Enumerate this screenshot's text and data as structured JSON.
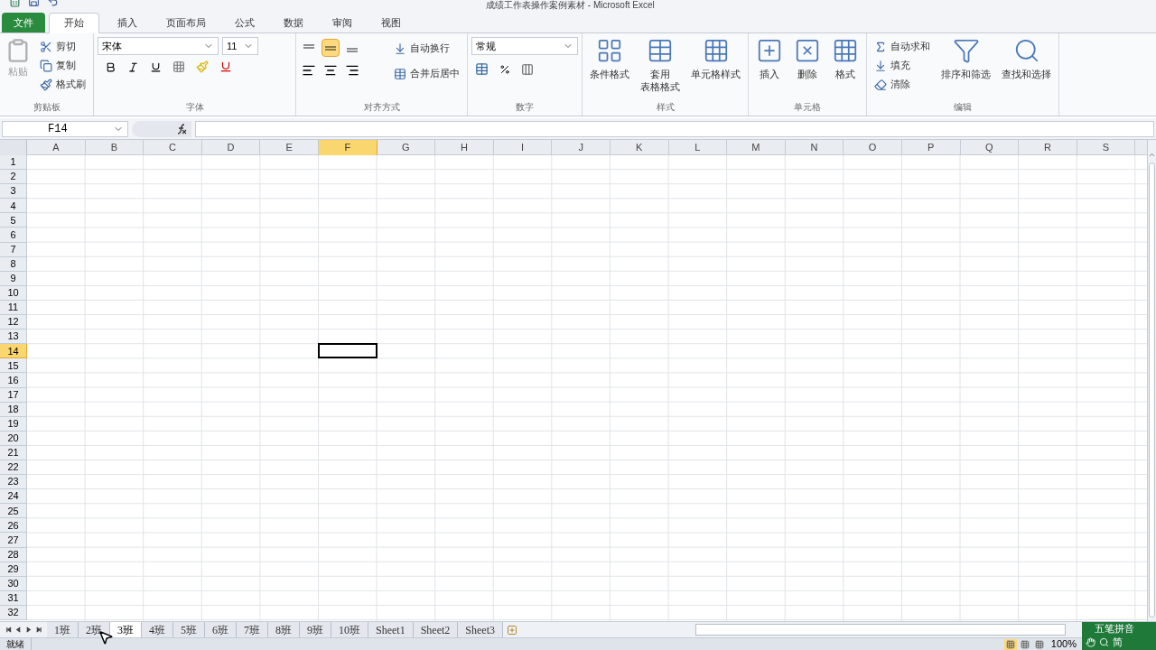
{
  "title": "成绩工作表操作案例素材 - Microsoft Excel",
  "menu_tabs": [
    {
      "label": "文件",
      "kind": "file",
      "selected": false
    },
    {
      "label": "开始",
      "kind": "tab",
      "selected": true
    },
    {
      "label": "插入",
      "kind": "tab",
      "selected": false
    },
    {
      "label": "页面布局",
      "kind": "tab",
      "selected": false
    },
    {
      "label": "公式",
      "kind": "tab",
      "selected": false
    },
    {
      "label": "数据",
      "kind": "tab",
      "selected": false
    },
    {
      "label": "审阅",
      "kind": "tab",
      "selected": false
    },
    {
      "label": "视图",
      "kind": "tab",
      "selected": false
    }
  ],
  "ribbon": {
    "clipboard": {
      "label": "剪贴板",
      "paste": {
        "label": "粘贴",
        "disabled": true
      },
      "items": [
        "剪切",
        "复制",
        "格式刷"
      ]
    },
    "font": {
      "label": "字体",
      "font_name": "宋体",
      "font_size": "11"
    },
    "alignment": {
      "label": "对齐方式",
      "vertical": [
        {
          "selected": false
        },
        {
          "selected": true
        },
        {
          "selected": false
        }
      ],
      "wrap": "自动换行",
      "merge": "合并后居中"
    },
    "number": {
      "label": "数字",
      "format": "常规"
    },
    "styles": {
      "label": "样式",
      "items": [
        {
          "lines": [
            "条件格式"
          ]
        },
        {
          "lines": [
            "套用",
            "表格格式"
          ]
        },
        {
          "lines": [
            "单元格样式"
          ]
        }
      ]
    },
    "cells": {
      "label": "单元格",
      "items": [
        "插入",
        "删除",
        "格式"
      ]
    },
    "editing": {
      "label": "编辑",
      "items": [
        "自动求和",
        "填充",
        "清除"
      ],
      "big": [
        "排序和筛选",
        "查找和选择"
      ]
    }
  },
  "name_box": "F14",
  "columns": [
    {
      "label": "A",
      "selected": false
    },
    {
      "label": "B",
      "selected": false
    },
    {
      "label": "C",
      "selected": false
    },
    {
      "label": "D",
      "selected": false
    },
    {
      "label": "E",
      "selected": false
    },
    {
      "label": "F",
      "selected": true
    },
    {
      "label": "G",
      "selected": false
    },
    {
      "label": "H",
      "selected": false
    },
    {
      "label": "I",
      "selected": false
    },
    {
      "label": "J",
      "selected": false
    },
    {
      "label": "K",
      "selected": false
    },
    {
      "label": "L",
      "selected": false
    },
    {
      "label": "M",
      "selected": false
    },
    {
      "label": "N",
      "selected": false
    },
    {
      "label": "O",
      "selected": false
    },
    {
      "label": "P",
      "selected": false
    },
    {
      "label": "Q",
      "selected": false
    },
    {
      "label": "R",
      "selected": false
    },
    {
      "label": "S",
      "selected": false
    }
  ],
  "rows": [
    {
      "label": "1",
      "selected": false
    },
    {
      "label": "2",
      "selected": false
    },
    {
      "label": "3",
      "selected": false
    },
    {
      "label": "4",
      "selected": false
    },
    {
      "label": "5",
      "selected": false
    },
    {
      "label": "6",
      "selected": false
    },
    {
      "label": "7",
      "selected": false
    },
    {
      "label": "8",
      "selected": false
    },
    {
      "label": "9",
      "selected": false
    },
    {
      "label": "10",
      "selected": false
    },
    {
      "label": "11",
      "selected": false
    },
    {
      "label": "12",
      "selected": false
    },
    {
      "label": "13",
      "selected": false
    },
    {
      "label": "14",
      "selected": true
    },
    {
      "label": "15",
      "selected": false
    },
    {
      "label": "16",
      "selected": false
    },
    {
      "label": "17",
      "selected": false
    },
    {
      "label": "18",
      "selected": false
    },
    {
      "label": "19",
      "selected": false
    },
    {
      "label": "20",
      "selected": false
    },
    {
      "label": "21",
      "selected": false
    },
    {
      "label": "22",
      "selected": false
    },
    {
      "label": "23",
      "selected": false
    },
    {
      "label": "24",
      "selected": false
    },
    {
      "label": "25",
      "selected": false
    },
    {
      "label": "26",
      "selected": false
    },
    {
      "label": "27",
      "selected": false
    },
    {
      "label": "28",
      "selected": false
    },
    {
      "label": "29",
      "selected": false
    },
    {
      "label": "30",
      "selected": false
    },
    {
      "label": "31",
      "selected": false
    },
    {
      "label": "32",
      "selected": false
    }
  ],
  "sheet_tabs": [
    {
      "label": "1班",
      "selected": false
    },
    {
      "label": "2班",
      "selected": false
    },
    {
      "label": "3班",
      "selected": true
    },
    {
      "label": "4班",
      "selected": false
    },
    {
      "label": "5班",
      "selected": false
    },
    {
      "label": "6班",
      "selected": false
    },
    {
      "label": "7班",
      "selected": false
    },
    {
      "label": "8班",
      "selected": false
    },
    {
      "label": "9班",
      "selected": false
    },
    {
      "label": "10班",
      "selected": false
    },
    {
      "label": "Sheet1",
      "selected": false
    },
    {
      "label": "Sheet2",
      "selected": false
    },
    {
      "label": "Sheet3",
      "selected": false
    }
  ],
  "status": "就绪",
  "views": [
    {
      "selected": true
    },
    {
      "selected": false
    },
    {
      "selected": false
    }
  ],
  "zoom": "100%",
  "ime": {
    "name": "五笔拼音",
    "mode": "简"
  }
}
